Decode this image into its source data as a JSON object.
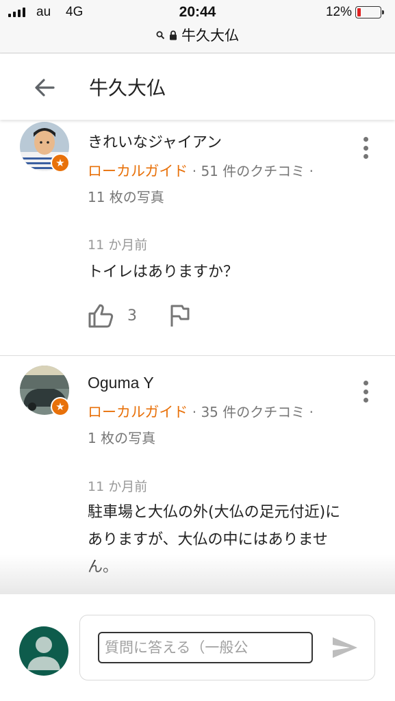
{
  "status_bar": {
    "carrier": "au",
    "network": "4G",
    "time": "20:44",
    "battery": "12%",
    "battery_level": 0.12,
    "url": "牛久大仏"
  },
  "header": {
    "title": "牛久大仏",
    "back_icon": "arrow-left-icon"
  },
  "reviews": [
    {
      "author": "きれいなジャイアン",
      "guide_label": "ローカルガイド",
      "review_count": " · 51 件のクチコミ ·",
      "photo_count": "11 枚の写真",
      "date": "11 か月前",
      "text": "トイレはありますか？",
      "likes": "3"
    },
    {
      "author": "Oguma Y",
      "guide_label": "ローカルガイド",
      "review_count": " · 35 件のクチコミ ·",
      "photo_count": "1 枚の写真",
      "date": "11 か月前",
      "text": "駐車場と大仏の外(大仏の足元付近)にありますが、大仏の中にはありません。"
    }
  ],
  "composer": {
    "placeholder": "質問に答える（一般公",
    "send_icon": "send-icon"
  },
  "colors": {
    "accent": "#e8710a",
    "avatar_me": "#0e5c4c"
  }
}
